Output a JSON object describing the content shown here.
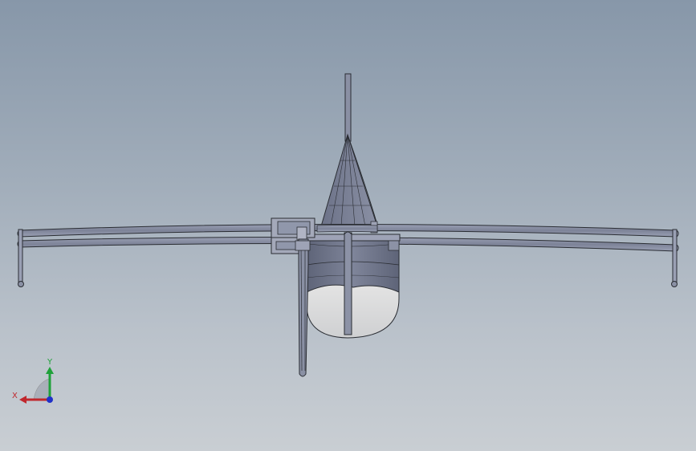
{
  "viewport": {
    "background_top": "#8797a9",
    "background_bottom": "#c9ced3"
  },
  "model": {
    "line_color": "#2a2d33",
    "hull_dark": "#6e7488",
    "hull_light": "#dcdcdc",
    "pole_color": "#8a90a6"
  },
  "triad": {
    "x_label": "X",
    "y_label": "Y",
    "x_color": "#c0272d",
    "y_color": "#1fa13a",
    "z_color": "#2031c8"
  }
}
